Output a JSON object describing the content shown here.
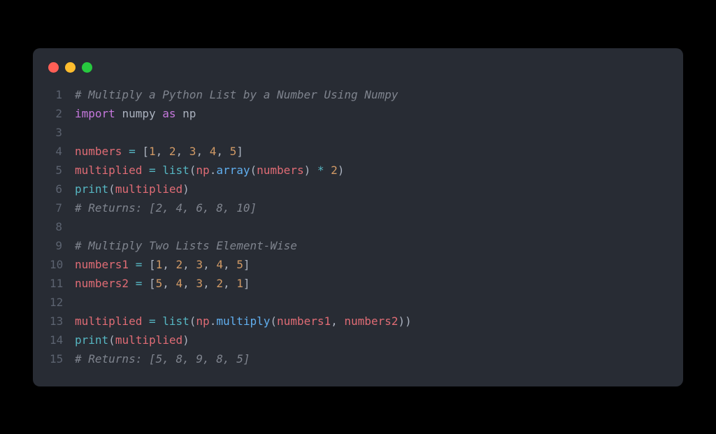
{
  "window": {
    "dots": [
      "red",
      "yellow",
      "green"
    ]
  },
  "code": {
    "lines": [
      {
        "n": "1",
        "tokens": [
          {
            "t": "# Multiply a Python List by a Number Using Numpy",
            "c": "comment"
          }
        ]
      },
      {
        "n": "2",
        "tokens": [
          {
            "t": "import",
            "c": "keyword"
          },
          {
            "t": " ",
            "c": "punct"
          },
          {
            "t": "numpy",
            "c": "module"
          },
          {
            "t": " ",
            "c": "punct"
          },
          {
            "t": "as",
            "c": "keyword"
          },
          {
            "t": " ",
            "c": "punct"
          },
          {
            "t": "np",
            "c": "module"
          }
        ]
      },
      {
        "n": "3",
        "tokens": []
      },
      {
        "n": "4",
        "tokens": [
          {
            "t": "numbers",
            "c": "var"
          },
          {
            "t": " ",
            "c": "punct"
          },
          {
            "t": "=",
            "c": "op"
          },
          {
            "t": " [",
            "c": "punct"
          },
          {
            "t": "1",
            "c": "num"
          },
          {
            "t": ", ",
            "c": "punct"
          },
          {
            "t": "2",
            "c": "num"
          },
          {
            "t": ", ",
            "c": "punct"
          },
          {
            "t": "3",
            "c": "num"
          },
          {
            "t": ", ",
            "c": "punct"
          },
          {
            "t": "4",
            "c": "num"
          },
          {
            "t": ", ",
            "c": "punct"
          },
          {
            "t": "5",
            "c": "num"
          },
          {
            "t": "]",
            "c": "punct"
          }
        ]
      },
      {
        "n": "5",
        "tokens": [
          {
            "t": "multiplied",
            "c": "var"
          },
          {
            "t": " ",
            "c": "punct"
          },
          {
            "t": "=",
            "c": "op"
          },
          {
            "t": " ",
            "c": "punct"
          },
          {
            "t": "list",
            "c": "builtin"
          },
          {
            "t": "(",
            "c": "punct"
          },
          {
            "t": "np",
            "c": "var"
          },
          {
            "t": ".",
            "c": "dot-op"
          },
          {
            "t": "array",
            "c": "func"
          },
          {
            "t": "(",
            "c": "punct"
          },
          {
            "t": "numbers",
            "c": "var"
          },
          {
            "t": ") ",
            "c": "punct"
          },
          {
            "t": "*",
            "c": "op"
          },
          {
            "t": " ",
            "c": "punct"
          },
          {
            "t": "2",
            "c": "num"
          },
          {
            "t": ")",
            "c": "punct"
          }
        ]
      },
      {
        "n": "6",
        "tokens": [
          {
            "t": "print",
            "c": "builtin"
          },
          {
            "t": "(",
            "c": "punct"
          },
          {
            "t": "multiplied",
            "c": "var"
          },
          {
            "t": ")",
            "c": "punct"
          }
        ]
      },
      {
        "n": "7",
        "tokens": [
          {
            "t": "# Returns: [2, 4, 6, 8, 10]",
            "c": "comment"
          }
        ]
      },
      {
        "n": "8",
        "tokens": []
      },
      {
        "n": "9",
        "tokens": [
          {
            "t": "# Multiply Two Lists Element-Wise",
            "c": "comment"
          }
        ]
      },
      {
        "n": "10",
        "tokens": [
          {
            "t": "numbers1",
            "c": "var"
          },
          {
            "t": " ",
            "c": "punct"
          },
          {
            "t": "=",
            "c": "op"
          },
          {
            "t": " [",
            "c": "punct"
          },
          {
            "t": "1",
            "c": "num"
          },
          {
            "t": ", ",
            "c": "punct"
          },
          {
            "t": "2",
            "c": "num"
          },
          {
            "t": ", ",
            "c": "punct"
          },
          {
            "t": "3",
            "c": "num"
          },
          {
            "t": ", ",
            "c": "punct"
          },
          {
            "t": "4",
            "c": "num"
          },
          {
            "t": ", ",
            "c": "punct"
          },
          {
            "t": "5",
            "c": "num"
          },
          {
            "t": "]",
            "c": "punct"
          }
        ]
      },
      {
        "n": "11",
        "tokens": [
          {
            "t": "numbers2",
            "c": "var"
          },
          {
            "t": " ",
            "c": "punct"
          },
          {
            "t": "=",
            "c": "op"
          },
          {
            "t": " [",
            "c": "punct"
          },
          {
            "t": "5",
            "c": "num"
          },
          {
            "t": ", ",
            "c": "punct"
          },
          {
            "t": "4",
            "c": "num"
          },
          {
            "t": ", ",
            "c": "punct"
          },
          {
            "t": "3",
            "c": "num"
          },
          {
            "t": ", ",
            "c": "punct"
          },
          {
            "t": "2",
            "c": "num"
          },
          {
            "t": ", ",
            "c": "punct"
          },
          {
            "t": "1",
            "c": "num"
          },
          {
            "t": "]",
            "c": "punct"
          }
        ]
      },
      {
        "n": "12",
        "tokens": []
      },
      {
        "n": "13",
        "tokens": [
          {
            "t": "multiplied",
            "c": "var"
          },
          {
            "t": " ",
            "c": "punct"
          },
          {
            "t": "=",
            "c": "op"
          },
          {
            "t": " ",
            "c": "punct"
          },
          {
            "t": "list",
            "c": "builtin"
          },
          {
            "t": "(",
            "c": "punct"
          },
          {
            "t": "np",
            "c": "var"
          },
          {
            "t": ".",
            "c": "dot-op"
          },
          {
            "t": "multiply",
            "c": "func"
          },
          {
            "t": "(",
            "c": "punct"
          },
          {
            "t": "numbers1",
            "c": "var"
          },
          {
            "t": ", ",
            "c": "punct"
          },
          {
            "t": "numbers2",
            "c": "var"
          },
          {
            "t": "))",
            "c": "punct"
          }
        ]
      },
      {
        "n": "14",
        "tokens": [
          {
            "t": "print",
            "c": "builtin"
          },
          {
            "t": "(",
            "c": "punct"
          },
          {
            "t": "multiplied",
            "c": "var"
          },
          {
            "t": ")",
            "c": "punct"
          }
        ]
      },
      {
        "n": "15",
        "tokens": [
          {
            "t": "# Returns: [5, 8, 9, 8, 5]",
            "c": "comment"
          }
        ]
      }
    ]
  }
}
